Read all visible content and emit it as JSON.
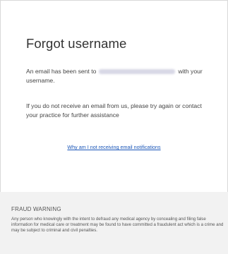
{
  "card": {
    "title": "Forgot username",
    "message1_before": "An email has been sent to",
    "message1_after": "with your username.",
    "message2": "If you do not receive an email from us, please try again or contact your practice for further assistance",
    "help_link": "Why am I not receiving email notifications"
  },
  "fraud": {
    "title": "FRAUD WARNING",
    "text": "Any person who knowingly with the intent to defraud any medical agency by concealing and filing false information for medical care or treatment may be found to have committed a fraudulent act which is a crime and may be subject to criminal and civil penalties."
  }
}
